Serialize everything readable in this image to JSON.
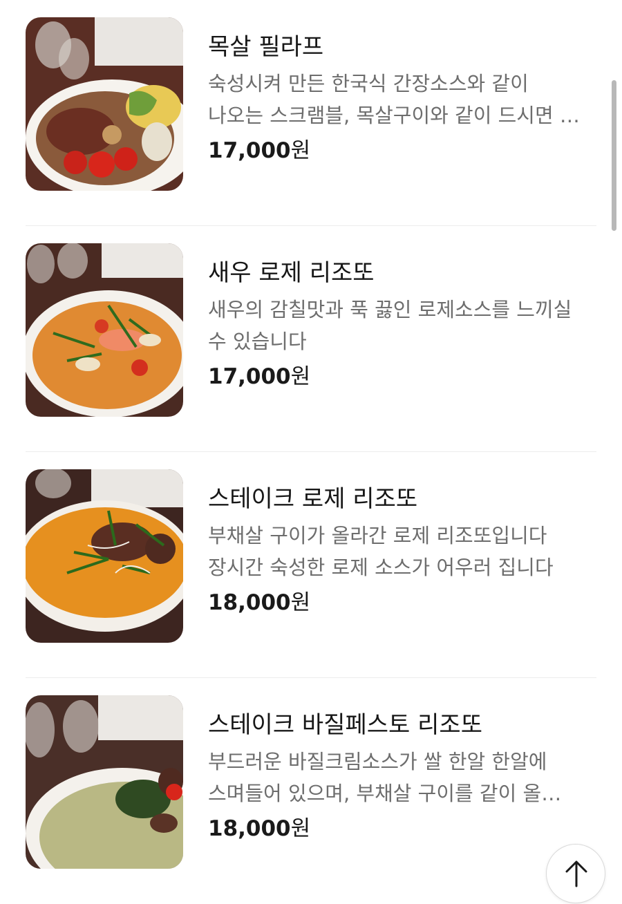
{
  "menu": {
    "currency": "원",
    "items": [
      {
        "name": "목살 필라프",
        "description": "숙성시켜 만든 한국식 간장소스와 같이 나오는 스크램블, 목살구이와 같이 드시면 …",
        "price": "17,000"
      },
      {
        "name": "새우 로제 리조또",
        "description": "새우의 감칠맛과 푹 끓인 로제소스를 느끼실 수 있습니다",
        "price": "17,000"
      },
      {
        "name": "스테이크 로제 리조또",
        "description": "부채살 구이가 올라간 로제 리조또입니다 장시간 숙성한 로제 소스가 어우러 집니다",
        "price": "18,000"
      },
      {
        "name": "스테이크 바질페스토 리조또",
        "description": "부드러운 바질크림소스가 쌀 한알 한알에 스며들어 있으며, 부채살 구이를 같이 올…",
        "price": "18,000"
      }
    ]
  },
  "icons": {
    "scroll_top": "arrow-up-icon"
  },
  "colors": {
    "text_primary": "#171717",
    "text_secondary": "#6d6d6d",
    "divider": "#ececec"
  }
}
